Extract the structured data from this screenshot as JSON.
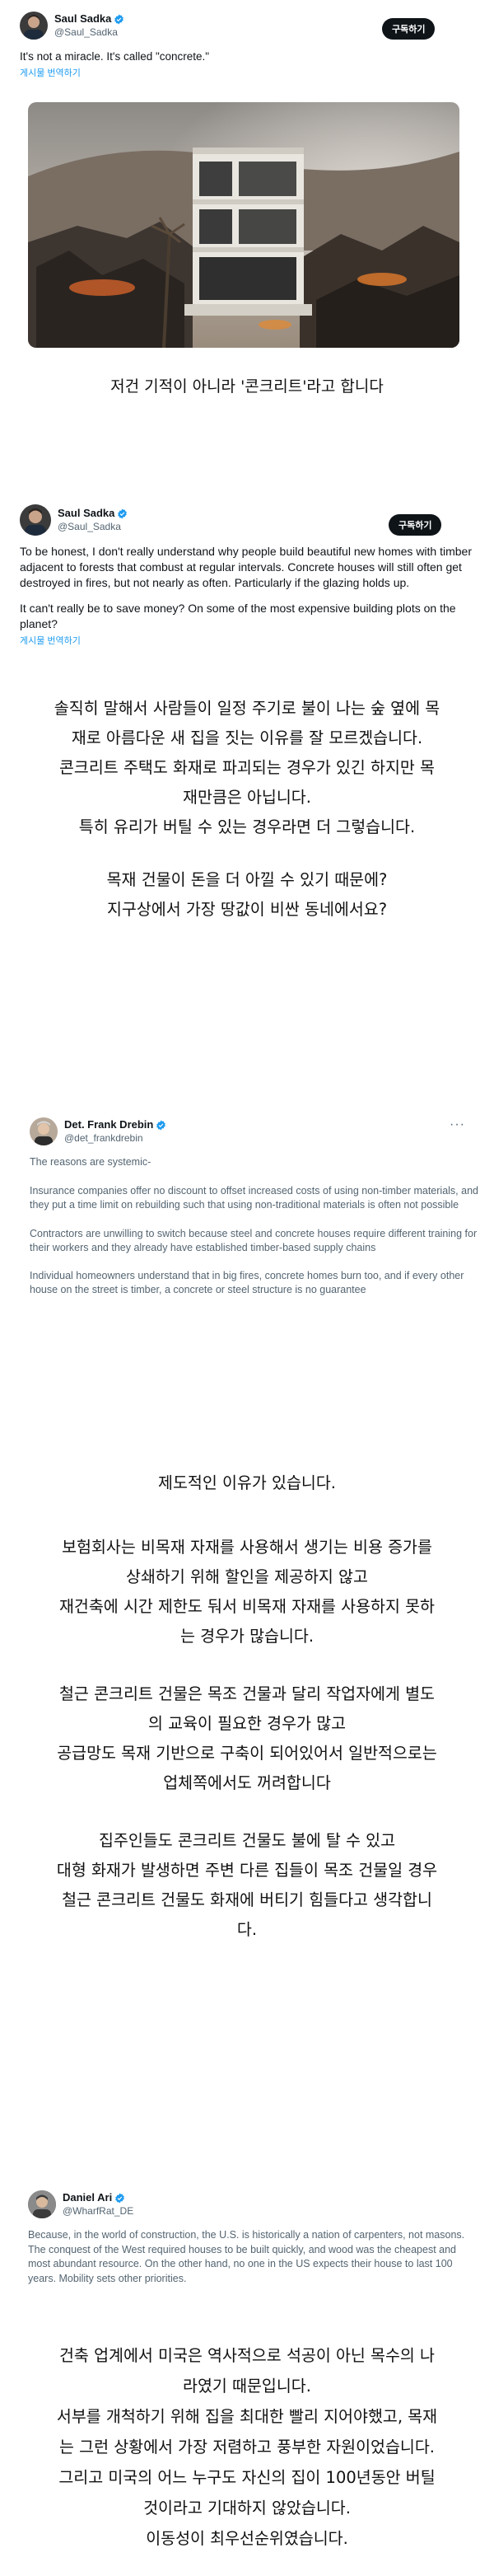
{
  "tweet1": {
    "name": "Saul Sadka",
    "handle": "@Saul_Sadka",
    "follow_label": "구독하기",
    "text": "It's not a miracle. It's called \"concrete.\"",
    "translate_label": "게시물 번역하기"
  },
  "caption1": "저건 기적이 아니라 '콘크리트'라고 합니다",
  "tweet2": {
    "name": "Saul Sadka",
    "handle": "@Saul_Sadka",
    "follow_label": "구독하기",
    "text_p1": "To be honest, I don't really understand why people build beautiful new homes with timber adjacent to forests that combust at regular intervals. Concrete houses will still often get destroyed in fires, but not nearly as often. Particularly if the glazing holds up.",
    "text_p2": "It can't really be to save money? On some of the most expensive building plots on the planet?",
    "translate_label": "게시물 번역하기"
  },
  "caption2": {
    "lines": [
      "솔직히 말해서 사람들이 일정 주기로 불이 나는 숲 옆에 목",
      "재로 아름다운 새 집을 짓는 이유를 잘 모르겠습니다.",
      "콘크리트 주택도 화재로 파괴되는 경우가 있긴 하지만 목",
      "재만큼은 아닙니다.",
      "특히 유리가 버틸 수 있는 경우라면 더 그렇습니다."
    ],
    "lines2": [
      "목재 건물이 돈을 더 아낄 수 있기 때문에?",
      "지구상에서 가장 땅값이 비싼 동네에서요?"
    ]
  },
  "tweet3": {
    "name": "Det. Frank Drebin",
    "handle": "@det_frankdrebin",
    "more_label": "···",
    "p1": "The reasons are systemic-",
    "p2": "Insurance companies offer no discount to offset increased costs of using non-timber materials, and they put a time limit on rebuilding such that using non-traditional materials is often not possible",
    "p3": "Contractors are unwilling to switch because steel and concrete houses require different training for their workers and they already have established timber-based supply chains",
    "p4": "Individual homeowners understand that in big fires, concrete homes burn too, and if every other house on the street is timber, a concrete or steel structure is no guarantee"
  },
  "caption3": {
    "intro": "제도적인 이유가 있습니다.",
    "block1": [
      "보험회사는 비목재 자재를 사용해서 생기는 비용 증가를",
      "상쇄하기 위해 할인을 제공하지 않고",
      "재건축에 시간 제한도 둬서 비목재 자재를 사용하지 못하",
      "는 경우가 많습니다."
    ],
    "block2": [
      "철근 콘크리트 건물은 목조 건물과 달리 작업자에게 별도",
      "의 교육이 필요한 경우가 많고",
      "공급망도 목재 기반으로 구축이 되어있어서 일반적으로는",
      "업체쪽에서도 꺼려합니다"
    ],
    "block3": [
      "집주인들도 콘크리트 건물도 불에 탈 수 있고",
      "대형 화재가 발생하면 주변 다른 집들이 목조 건물일 경우",
      "철근 콘크리트 건물도 화재에 버티기 힘들다고 생각합니",
      "다."
    ]
  },
  "tweet4": {
    "name": "Daniel Ari",
    "handle": "@WharfRat_DE",
    "text": "Because, in the world of construction, the U.S. is historically a nation of carpenters, not masons. The conquest of the West required houses to be built quickly, and wood was the cheapest and most abundant resource. On the other hand, no one in the US expects their house to last 100 years. Mobility sets other priorities."
  },
  "caption4": {
    "lines": [
      "건축 업계에서 미국은 역사적으로 석공이 아닌 목수의 나",
      "라였기 때문입니다.",
      "서부를 개척하기 위해 집을 최대한 빨리 지어야했고, 목재",
      "는 그런 상황에서 가장 저렴하고 풍부한 자원이었습니다.",
      "그리고 미국의 어느 누구도 자신의 집이 100년동안 버틸",
      "것이라고 기대하지 않았습니다.",
      "이동성이 최우선순위였습니다."
    ]
  },
  "colors": {
    "verified": "#1d9bf0",
    "link": "#1d9bf0",
    "button": "#0f1419",
    "muted": "#536471"
  },
  "icons": {
    "verified": "verified-badge-icon",
    "more": "more-dots-icon"
  }
}
